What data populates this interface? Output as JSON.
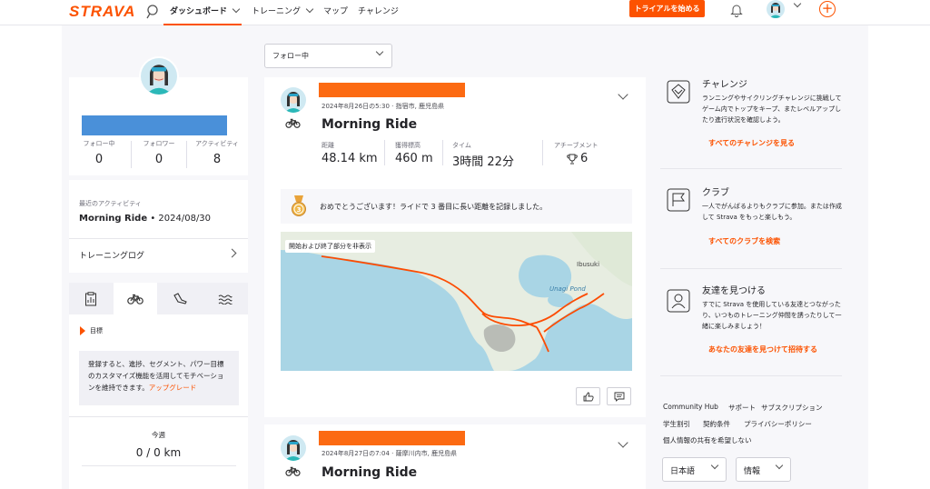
{
  "nav": {
    "logo": "STRAVA",
    "items": [
      {
        "label": "ダッシュボード",
        "active": true
      },
      {
        "label": "トレーニング",
        "active": false
      },
      {
        "label": "マップ",
        "active": false
      },
      {
        "label": "チャレンジ",
        "active": false
      }
    ],
    "trial_button": "トライアルを始める",
    "plus": "+"
  },
  "profile": {
    "stats": [
      {
        "label": "フォロー中",
        "value": "0"
      },
      {
        "label": "フォロワー",
        "value": "0"
      },
      {
        "label": "アクティビティ",
        "value": "8"
      }
    ],
    "recent_label": "最近のアクティビティ",
    "recent_name": "Morning Ride",
    "recent_date": " • 2024/08/30",
    "training_log": "トレーニングログ"
  },
  "goals": {
    "heading": "目標",
    "promo_text": "登録すると、進捗、セグメント、パワー目標のカスタマイズ機能を活用してモチベーションを維持できます。",
    "promo_link": "アップグレード",
    "week_label": "今週",
    "week_value": "0 / 0 km"
  },
  "feed": {
    "filter": "フォロー中",
    "activities": [
      {
        "meta": "2024年8月26日の5:30 · 指宿市, 鹿児島県",
        "title": "Morning Ride",
        "metrics": [
          {
            "label": "距離",
            "value": "48.14 km"
          },
          {
            "label": "獲得標高",
            "value": "460 m"
          },
          {
            "label": "タイム",
            "value": "3時間 22分"
          },
          {
            "label": "アチーブメント",
            "value": "6"
          }
        ],
        "achievement": "おめでとうございます！ライドで 3 番目に長い距離を記録しました。",
        "map_toggle": "開始および終了部分を非表示",
        "map_labels": {
          "town": "Ibusuki",
          "pond": "Unagi Pond"
        }
      },
      {
        "meta": "2024年8月27日の7:04 · 薩摩川内市, 鹿児島県",
        "title": "Morning Ride"
      }
    ]
  },
  "sidebar": {
    "sections": [
      {
        "title": "チャレンジ",
        "desc": "ランニングやサイクリングチャレンジに挑戦してゲーム内でトップをキープ、またレベルアップしたり進行状況を確認しよう。",
        "link": "すべてのチャレンジを見る"
      },
      {
        "title": "クラブ",
        "desc": "一人でがんばるよりもクラブに参加。または作成して Strava をもっと楽しもう。",
        "link": "すべてのクラブを検索"
      },
      {
        "title": "友達を見つける",
        "desc": "すでに Strava を使用している友達とつながったり、いつものトレーニング仲間を誘ったりして一緒に楽しみましょう！",
        "link": "あなたの友達を見つけて招待する"
      }
    ],
    "footer": {
      "row1": [
        "Community Hub",
        "サポート",
        "サブスクリプション"
      ],
      "row2": [
        "学生割引",
        "契約条件",
        "プライバシーポリシー"
      ],
      "row3": "個人情報の共有を希望しない",
      "language": "日本語",
      "info": "情報"
    }
  },
  "colors": {
    "brand": "#fc5200",
    "background": "#f7f7fa",
    "redaction": "#4a90d9"
  }
}
